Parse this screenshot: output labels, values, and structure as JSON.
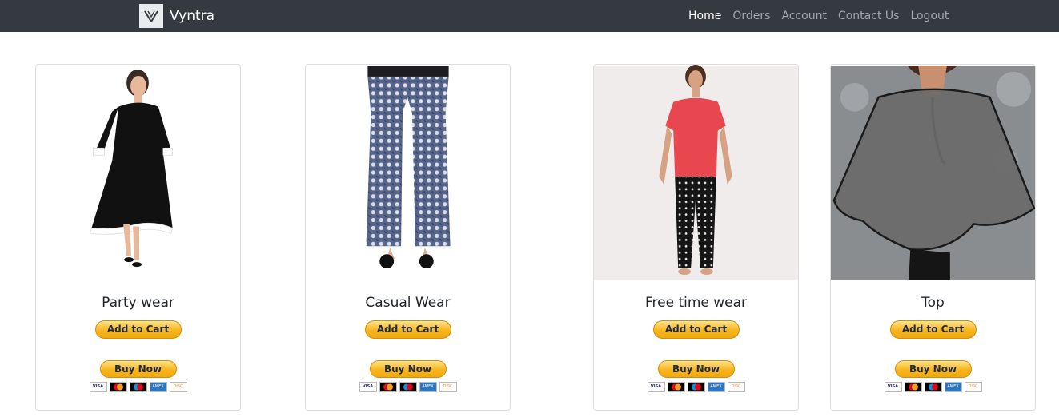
{
  "brand": {
    "name": "Vyntra",
    "logo_icon": "v-logo-icon"
  },
  "nav": {
    "items": [
      {
        "label": "Home",
        "active": true
      },
      {
        "label": "Orders",
        "active": false
      },
      {
        "label": "Account",
        "active": false
      },
      {
        "label": "Contact Us",
        "active": false
      },
      {
        "label": "Logout",
        "active": false
      }
    ]
  },
  "products": [
    {
      "title": "Party wear",
      "add_label": "Add to Cart",
      "buy_label": "Buy Now"
    },
    {
      "title": "Casual Wear",
      "add_label": "Add to Cart",
      "buy_label": "Buy Now"
    },
    {
      "title": "Free time wear",
      "add_label": "Add to Cart",
      "buy_label": "Buy Now"
    },
    {
      "title": "Top",
      "add_label": "Add to Cart",
      "buy_label": "Buy Now"
    }
  ],
  "payment_cards": [
    "VISA",
    "MC",
    "MAESTRO",
    "AMEX",
    "DISCOVER"
  ],
  "colors": {
    "navbar": "#343a40",
    "button": "#f8b51d",
    "button_text": "#1b2a4a"
  }
}
